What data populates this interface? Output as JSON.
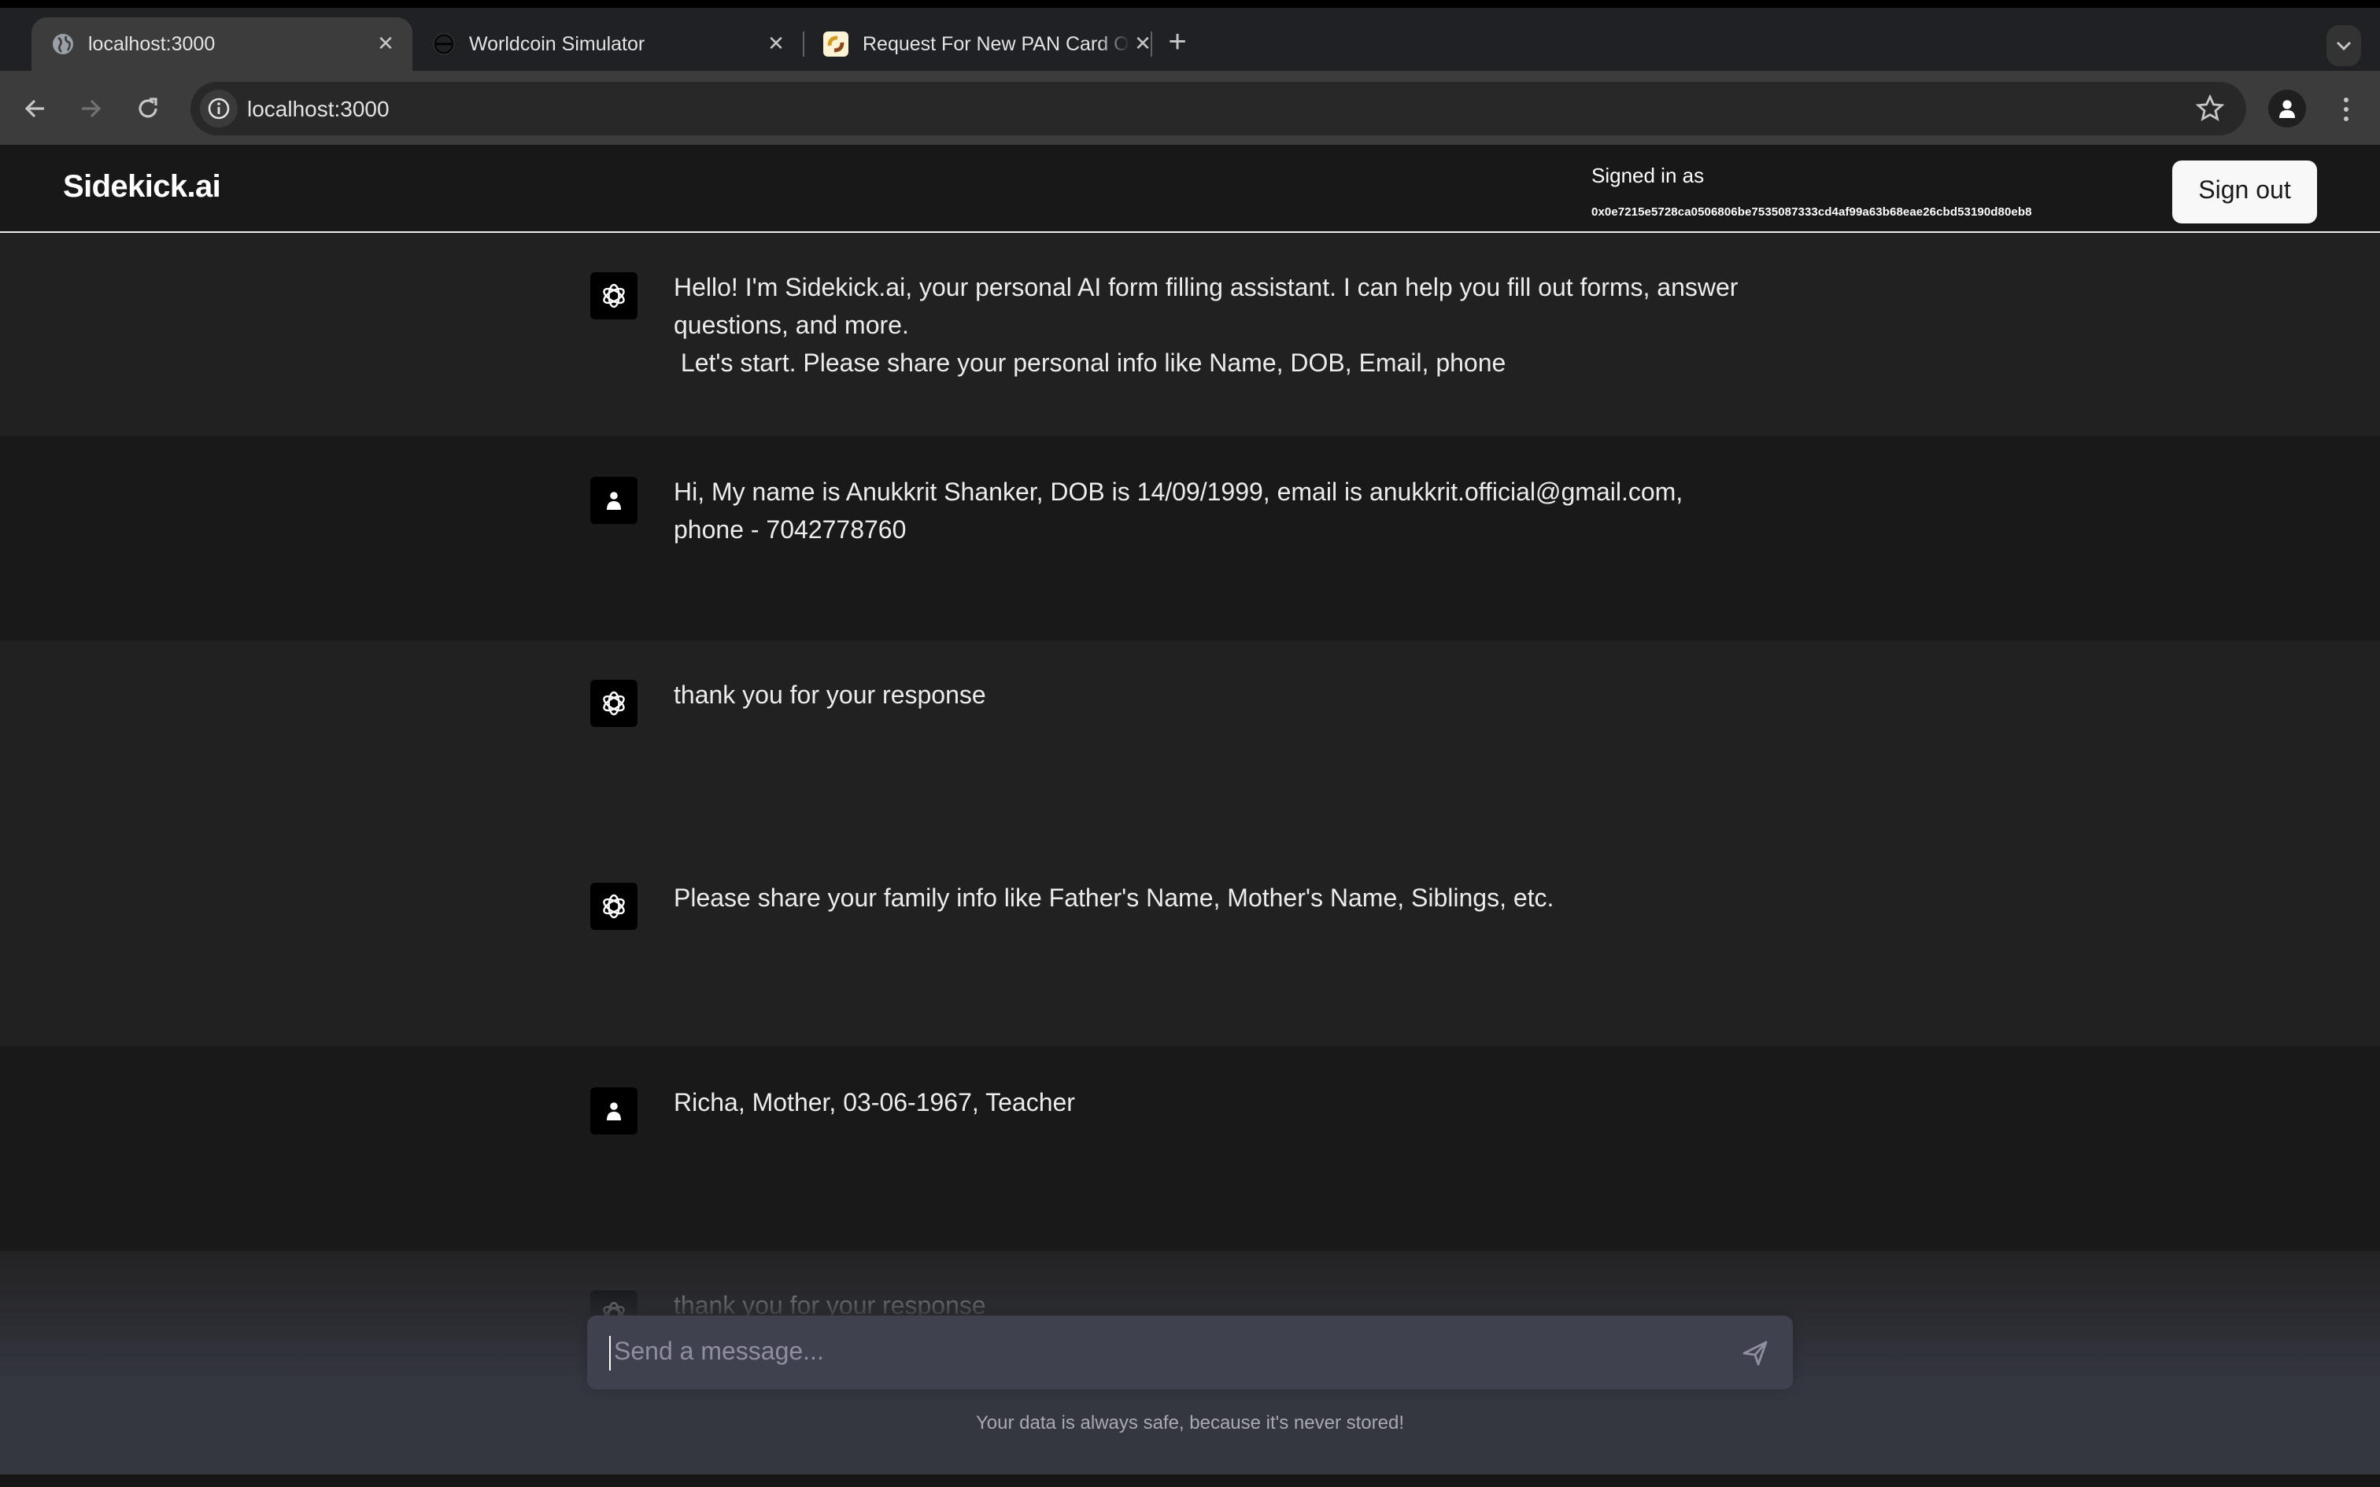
{
  "browser": {
    "tabs": [
      {
        "title": "localhost:3000",
        "favicon": "globe-icon",
        "active": true
      },
      {
        "title": "Worldcoin Simulator",
        "favicon": "worldcoin-icon",
        "active": false
      },
      {
        "title": "Request For New PAN Card O",
        "favicon": "pan-card-icon",
        "active": false
      }
    ],
    "new_tab_label": "+",
    "tab_menu_label": "⌄",
    "address_bar": {
      "url": "localhost:3000"
    }
  },
  "header": {
    "logo": "Sidekick.ai",
    "signed_in_label": "Signed in as",
    "address": "0x0e7215e5728ca0506806be7535087333cd4af99a63b68eae26cbd53190d80eb8",
    "sign_out_label": "Sign out"
  },
  "messages": [
    {
      "role": "assistant",
      "avatar": "openai-icon",
      "text": "Hello! I'm Sidekick.ai, your personal AI form filling assistant. I can help you fill out forms, answer questions, and more.\n Let's start. Please share your personal info like Name, DOB, Email, phone"
    },
    {
      "role": "user",
      "avatar": "user-icon",
      "text": "Hi, My name is Anukkrit Shanker, DOB is 14/09/1999, email is anukkrit.official@gmail.com, phone - 7042778760"
    },
    {
      "role": "assistant",
      "avatar": "openai-icon",
      "text": "thank you for your response"
    },
    {
      "role": "assistant",
      "avatar": "openai-icon",
      "text": "Please share your family info like Father's Name, Mother's Name, Siblings, etc."
    },
    {
      "role": "user",
      "avatar": "user-icon",
      "text": "Richa, Mother, 03-06-1967, Teacher"
    },
    {
      "role": "assistant",
      "avatar": "openai-icon",
      "text": "thank you for your response"
    }
  ],
  "composer": {
    "value": "",
    "placeholder": "Send a message..."
  },
  "footnote": "Your data is always safe, because it's never stored!",
  "colors": {
    "assistant_row": "#212121",
    "user_row": "#191919",
    "composer_bg": "#40414f",
    "header_bg": "#181818"
  }
}
